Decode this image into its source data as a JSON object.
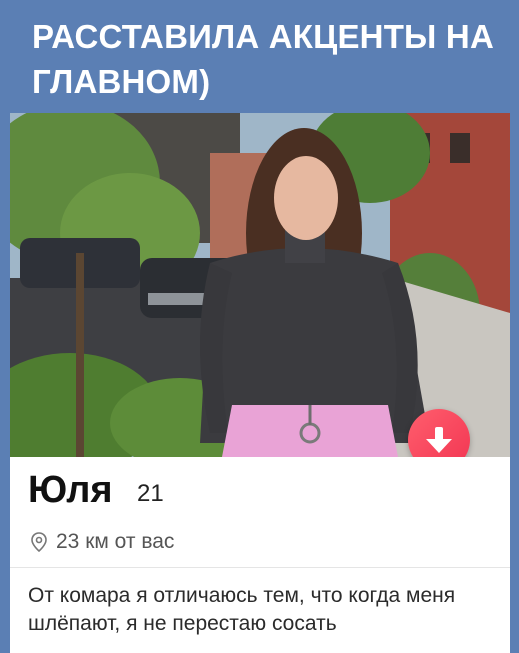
{
  "header": {
    "caption": "РАССТАВИЛА АКЦЕНТЫ НА ГЛАВНОМ)"
  },
  "profile": {
    "name": "Юля",
    "age": "21",
    "distance": "23 км от вас",
    "bio": "От комара я отличаюсь тем, что когда меня шлёпают, я не перестаю сосать",
    "photo_icon": "profile-photo"
  },
  "actions": {
    "dislike_icon": "arrow-down-icon",
    "dislike_color": "#f23552"
  },
  "colors": {
    "background": "#5b7fb4",
    "card": "#ffffff"
  }
}
